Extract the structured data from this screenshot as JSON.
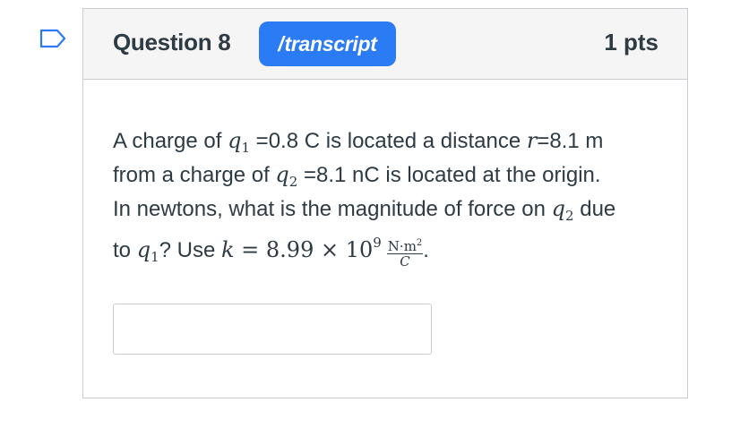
{
  "flag_icon": "bookmark-flag-icon",
  "question": {
    "title": "Question 8",
    "badge_label": "transcript",
    "badge_color": "#2b7bf5",
    "points": "1 pts"
  },
  "prompt": {
    "line1": {
      "t1": "A charge of ",
      "var_q": "q",
      "sub_1": "1",
      "t2": " =0.8 C is located a distance ",
      "var_r": "r",
      "t3": "=8.1 m"
    },
    "line2": {
      "t1": "from a charge of ",
      "var_q": "q",
      "sub_2": "2",
      "t2": " =8.1 nC is located at the origin."
    },
    "line3": {
      "t1": "In newtons, what is the magnitude of force on ",
      "var_q": "q",
      "sub_2": "2",
      "t2": " due"
    },
    "line4": {
      "t1": "to ",
      "var_q": "q",
      "sub_1": "1",
      "t2": "? Use ",
      "var_k": "k",
      "eq": " = 8.99 × 10",
      "exp": "9",
      "frac_num": "N·m",
      "frac_num_exp": "2",
      "frac_den": "C",
      "t3": "."
    }
  },
  "answer_field": {
    "value": "",
    "placeholder": ""
  }
}
